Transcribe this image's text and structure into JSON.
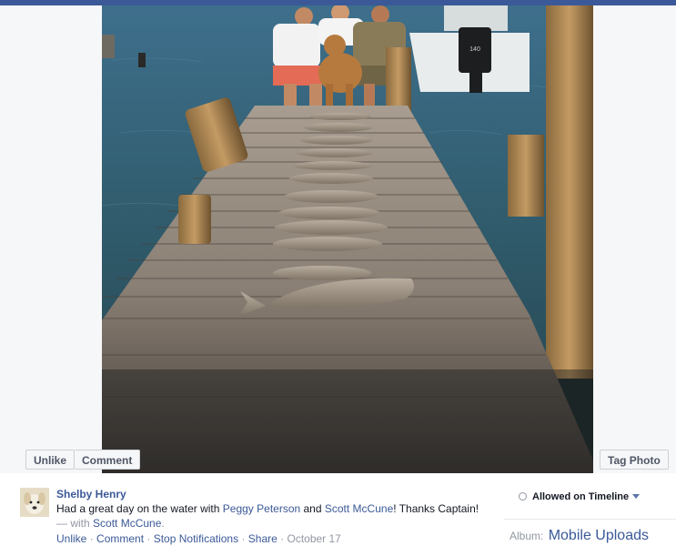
{
  "photo": {
    "controls": {
      "unlike_label": "Unlike",
      "comment_label": "Comment",
      "tag_label": "Tag Photo"
    },
    "motor_badge": "140"
  },
  "post": {
    "author": "Shelby Henry",
    "caption": {
      "prefix": "Had a great day on the water with ",
      "tag1": "Peggy Peterson",
      "middle": " and ",
      "tag2": "Scott McCune",
      "suffix": "! Thanks Captain!"
    },
    "with": {
      "prefix": "— with ",
      "name": "Scott McCune",
      "suffix": "."
    },
    "actions": {
      "unlike": "Unlike",
      "comment": "Comment",
      "stop_notifications": "Stop Notifications",
      "share": "Share",
      "date": "October 17",
      "separator": " · "
    }
  },
  "sidebar": {
    "privacy_label": "Allowed on Timeline",
    "album_prefix": "Album:",
    "album_name": "Mobile Uploads"
  },
  "colors": {
    "brand_blue": "#3b5998",
    "muted_text": "#9197a3",
    "button_text": "#4e5665"
  }
}
